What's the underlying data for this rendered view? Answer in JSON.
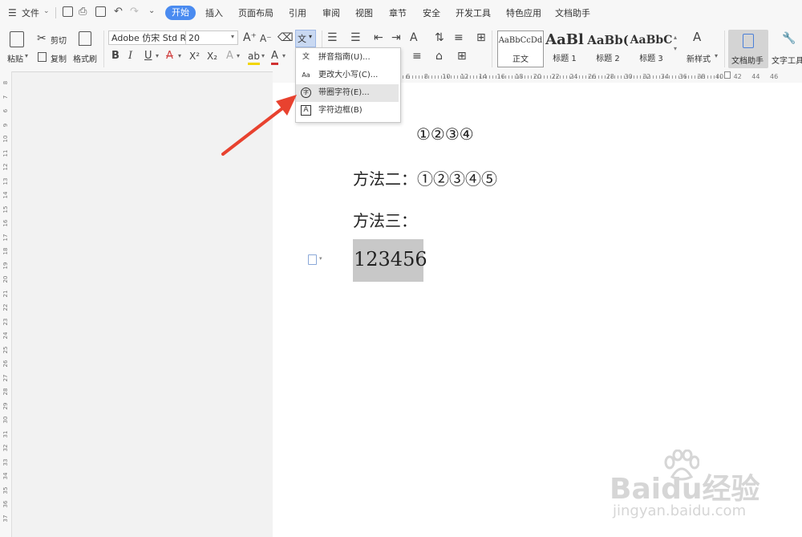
{
  "menubar": {
    "menu_icon": "hamburger-icon",
    "file": "文件",
    "tabs": [
      "开始",
      "插入",
      "页面布局",
      "引用",
      "审阅",
      "视图",
      "章节",
      "安全",
      "开发工具",
      "特色应用",
      "文档助手"
    ],
    "active_tab": "开始",
    "accent": "#4a8bf0"
  },
  "ribbon": {
    "paste": "粘贴",
    "cut": "剪切",
    "copy": "复制",
    "format_painter": "格式刷",
    "font_name": "Adobe 仿宋 Std R",
    "font_size": "20",
    "bold": "B",
    "italic": "I",
    "underline": "U",
    "strike": "A",
    "superscript": "X²",
    "subscript": "X₂",
    "styles": [
      {
        "preview": "AaBbCcDd",
        "name": "正文"
      },
      {
        "preview": "AaBl",
        "name": "标题 1"
      },
      {
        "preview": "AaBb(",
        "name": "标题 2"
      },
      {
        "preview": "AaBbC",
        "name": "标题 3"
      }
    ],
    "new_style": "新样式",
    "doc_assistant": "文档助手",
    "text_tools": "文字工具"
  },
  "ruler": {
    "h_ticks": [
      "6",
      "8",
      "10",
      "12",
      "14",
      "16",
      "18",
      "20",
      "22",
      "24",
      "26",
      "28",
      "30",
      "32",
      "34",
      "36",
      "38",
      "40",
      "42",
      "44",
      "46"
    ],
    "v_ticks": [
      "8",
      "7",
      "6",
      "9",
      "10",
      "11",
      "12",
      "13",
      "14",
      "15",
      "16",
      "17",
      "18",
      "19",
      "20",
      "21",
      "22",
      "23",
      "24",
      "25",
      "26",
      "27",
      "28",
      "29",
      "30",
      "31",
      "32",
      "33",
      "34",
      "35",
      "36",
      "37"
    ]
  },
  "dropdown": {
    "items": [
      {
        "icon": "pinyin-icon",
        "glyph": "文",
        "label": "拼音指南(U)..."
      },
      {
        "icon": "change-case-icon",
        "glyph": "Aa",
        "label": "更改大小写(C)..."
      },
      {
        "icon": "enclosed-char-icon",
        "glyph": "字",
        "label": "带圈字符(E)..."
      },
      {
        "icon": "char-border-icon",
        "glyph": "A",
        "label": "字符边框(B)"
      }
    ],
    "highlight": "#e5e5e5"
  },
  "document": {
    "line1": "①②③④",
    "line2": "方法二：①②③④⑤",
    "line3": "方法三：",
    "line4": "123456",
    "selection_color": "#c8c8c8"
  },
  "annotation": {
    "arrow_color": "#e8422f"
  },
  "watermark": {
    "brand": "Baidu经验",
    "url": "jingyan.baidu.com"
  }
}
